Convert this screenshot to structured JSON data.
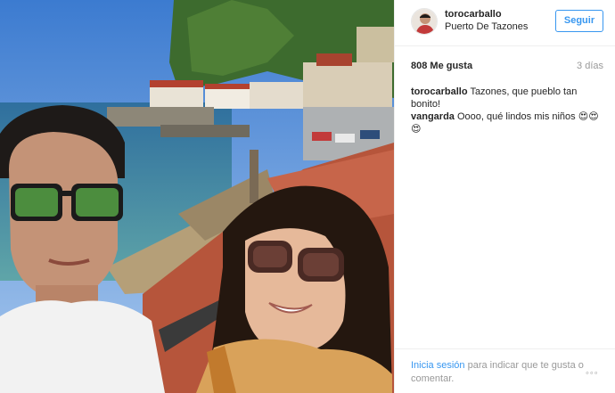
{
  "post": {
    "username": "torocarballo",
    "location": "Puerto De Tazones",
    "follow_label": "Seguir",
    "likes": "808 Me gusta",
    "time": "3 días",
    "comments": [
      {
        "user": "torocarballo",
        "text": "Tazones, que pueblo tan bonito!"
      },
      {
        "user": "vangarda",
        "text": "Oooo, qué lindos mis niños 😍😍😍"
      }
    ],
    "footer": {
      "login_label": "Inicia sesión",
      "text": "para indicar que te gusta o comentar.",
      "more_label": "◦◦◦"
    }
  },
  "colors": {
    "accent": "#3897f0",
    "muted": "#999999",
    "text": "#262626"
  }
}
